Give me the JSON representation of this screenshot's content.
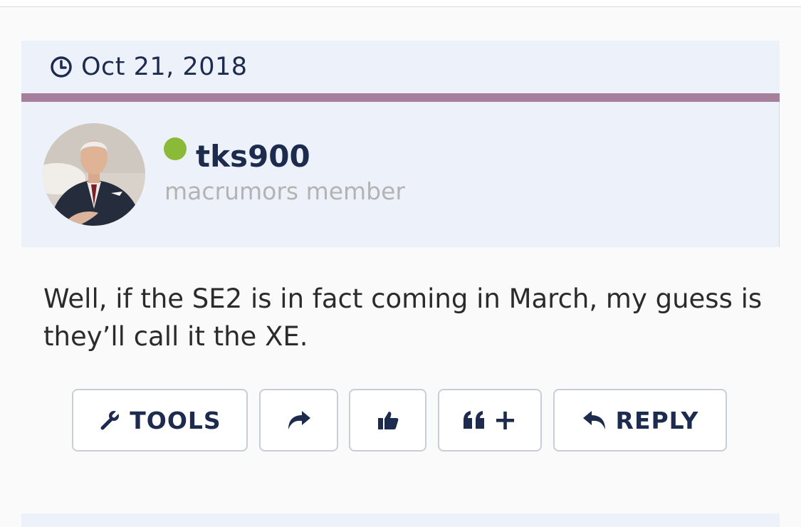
{
  "post": {
    "date": "Oct 21, 2018",
    "author": {
      "username": "tks900",
      "title": "macrumors member",
      "online": true
    },
    "message": "Well, if the SE2 is in fact coming in March, my guess is they’ll call it the XE."
  },
  "actions": {
    "tools_label": "TOOLS",
    "quote_plus": "+",
    "reply_label": "REPLY"
  },
  "colors": {
    "accent": "#a57f9b",
    "navy": "#1d2b4f",
    "panel_bg": "#edf2fa",
    "online": "#8bba38"
  },
  "icons": [
    "clock-icon",
    "wrench-icon",
    "share-icon",
    "thumbs-up-icon",
    "quote-icon",
    "reply-icon"
  ]
}
